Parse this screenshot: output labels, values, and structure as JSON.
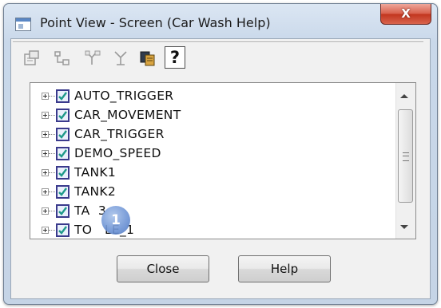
{
  "window": {
    "title": "Point View - Screen (Car Wash Help)",
    "close_label": "X"
  },
  "toolbar": {
    "icons": [
      "properties-icon",
      "tree-icon",
      "branch-icon",
      "hierarchy-icon",
      "copy-icon",
      "help-icon"
    ],
    "help_label": "?"
  },
  "tree": {
    "items": [
      {
        "label": "AUTO_TRIGGER",
        "checked": true
      },
      {
        "label": "CAR_MOVEMENT",
        "checked": true
      },
      {
        "label": "CAR_TRIGGER",
        "checked": true
      },
      {
        "label": "DEMO_SPEED",
        "checked": true
      },
      {
        "label": "TANK1",
        "checked": true
      },
      {
        "label": "TANK2",
        "checked": true
      },
      {
        "label": "TA  3",
        "checked": true
      },
      {
        "label": "TO   LE_1",
        "checked": true
      }
    ]
  },
  "callout": {
    "number": "1"
  },
  "buttons": {
    "close": "Close",
    "help": "Help"
  },
  "colors": {
    "title_close": "#c2351e",
    "checkbox_border": "#3a3a8c",
    "check_mark": "#1f9a8a",
    "callout": "#6f95d6"
  }
}
